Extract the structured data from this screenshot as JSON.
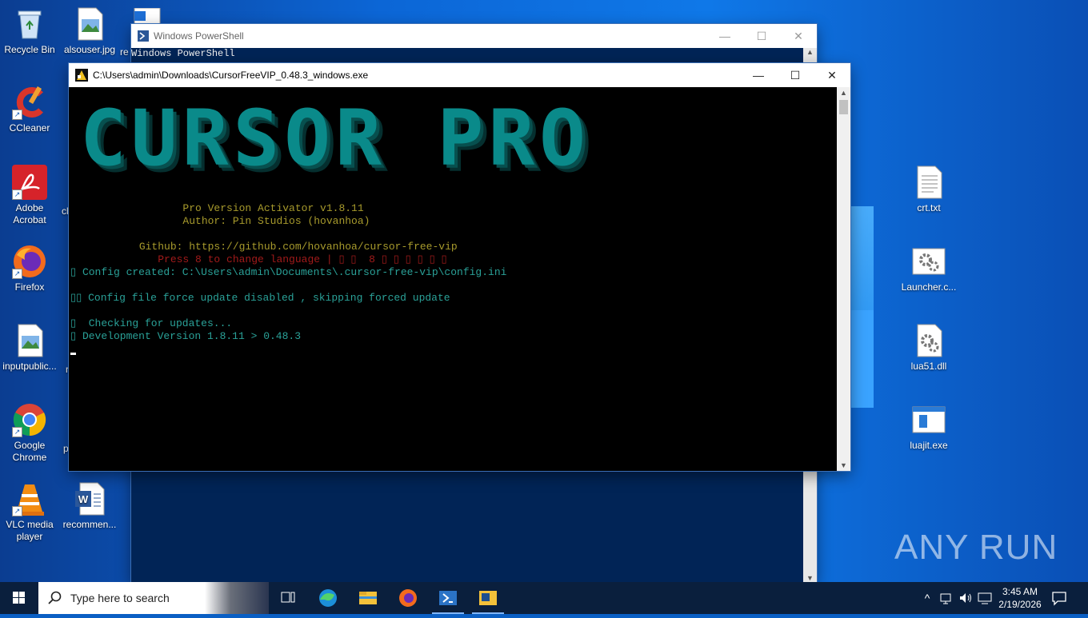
{
  "desktop": {
    "left_icons": [
      {
        "label": "Recycle Bin",
        "icon": "recycle-bin-icon"
      },
      {
        "label": "alsouser.jpg",
        "icon": "image-file-icon"
      },
      {
        "label": "CCleaner",
        "icon": "ccleaner-icon"
      },
      {
        "label": "Adobe Acrobat",
        "icon": "acrobat-icon"
      },
      {
        "label": "Firefox",
        "icon": "firefox-icon"
      },
      {
        "label": "inputpublic...",
        "icon": "image-file-icon"
      },
      {
        "label": "Google Chrome",
        "icon": "chrome-icon"
      },
      {
        "label": "VLC media player",
        "icon": "vlc-icon"
      },
      {
        "label": "recommen...",
        "icon": "word-doc-icon"
      }
    ],
    "partial_labels": [
      "re",
      "cl",
      "p",
      "r"
    ],
    "right_icons": [
      {
        "label": "crt.txt",
        "icon": "text-file-icon"
      },
      {
        "label": "Launcher.c...",
        "icon": "settings-file-icon"
      },
      {
        "label": "lua51.dll",
        "icon": "dll-file-icon"
      },
      {
        "label": "luajit.exe",
        "icon": "exe-file-icon"
      }
    ]
  },
  "powershell_window": {
    "title": "Windows PowerShell",
    "line1": "Windows PowerShell"
  },
  "cursor_window": {
    "title": "C:\\Users\\admin\\Downloads\\CursorFreeVIP_0.48.3_windows.exe",
    "banner": "CURSOR PRO",
    "lines": [
      {
        "text": "Pro Version Activator v1.8.11",
        "color": "#a79a2c",
        "indent": "                  "
      },
      {
        "text": "Author: Pin Studios (hovanhoa)",
        "color": "#a79a2c",
        "indent": "                  "
      },
      {
        "text": "",
        "color": "#ccc",
        "indent": ""
      },
      {
        "text": "Github: https://github.com/hovanhoa/cursor-free-vip",
        "color": "#a79a2c",
        "indent": "           "
      },
      {
        "text": "Press 8 to change language | ▯ ▯  8 ▯ ▯ ▯ ▯ ▯ ▯",
        "color": "#a11a1a",
        "indent": "              "
      },
      {
        "text": "▯ Config created: C:\\Users\\admin\\Documents\\.cursor-free-vip\\config.ini",
        "color": "#2aa198",
        "indent": ""
      },
      {
        "text": "",
        "color": "#ccc",
        "indent": ""
      },
      {
        "text": "▯▯ Config file force update disabled , skipping forced update",
        "color": "#2aa198",
        "indent": ""
      },
      {
        "text": "",
        "color": "#ccc",
        "indent": ""
      },
      {
        "text": "▯  Checking for updates...",
        "color": "#2aa198",
        "indent": ""
      },
      {
        "text": "▯ Development Version 1.8.11 > 0.48.3",
        "color": "#2aa198",
        "indent": ""
      }
    ]
  },
  "taskbar": {
    "search_placeholder": "Type here to search",
    "apps": [
      "task-view-icon",
      "edge-icon",
      "file-explorer-icon",
      "firefox-icon",
      "powershell-icon",
      "exe-app-icon"
    ],
    "time": "3:45 AM",
    "date": "2/19/2026"
  },
  "watermark": "ANY RUN"
}
